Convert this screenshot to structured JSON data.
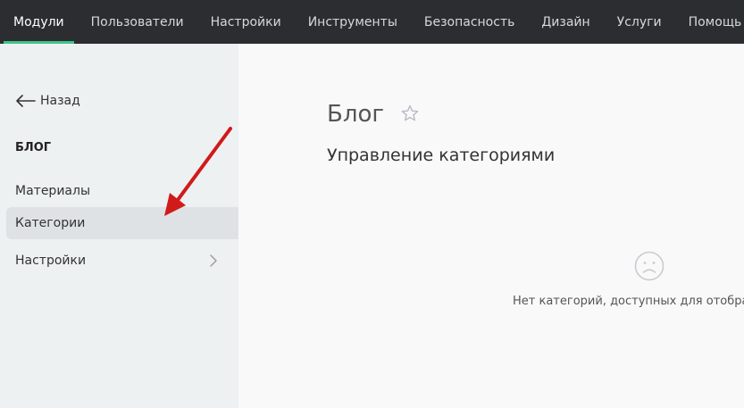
{
  "topnav": {
    "items": [
      {
        "label": "Модули",
        "active": true
      },
      {
        "label": "Пользователи"
      },
      {
        "label": "Настройки"
      },
      {
        "label": "Инструменты"
      },
      {
        "label": "Безопасность"
      },
      {
        "label": "Дизайн"
      },
      {
        "label": "Услуги"
      },
      {
        "label": "Помощь"
      }
    ]
  },
  "sidebar": {
    "back_label": "Назад",
    "section_title": "БЛОГ",
    "items": [
      {
        "label": "Материалы"
      },
      {
        "label": "Категории",
        "selected": true
      },
      {
        "label": "Настройки",
        "has_submenu": true
      }
    ]
  },
  "main": {
    "title": "Блог",
    "subtitle": "Управление категориями",
    "empty_message": "Нет категорий, доступных для отобра"
  },
  "colors": {
    "topbar_bg": "#2b2d31",
    "accent": "#3fc48a",
    "sidebar_bg": "#eef1f2",
    "annotation_arrow": "#d11a1a"
  },
  "icons": {
    "back": "arrow-left-icon",
    "favorite": "star-outline-icon",
    "submenu": "chevron-right-icon",
    "empty": "sad-face-icon"
  }
}
